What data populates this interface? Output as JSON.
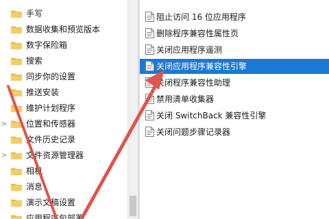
{
  "tree": {
    "items": [
      {
        "label": "手写",
        "chevron": ""
      },
      {
        "label": "数据收集和预览版本",
        "chevron": ""
      },
      {
        "label": "数字保险箱",
        "chevron": ""
      },
      {
        "label": "搜索",
        "chevron": ""
      },
      {
        "label": "同步你的设置",
        "chevron": ""
      },
      {
        "label": "推送安装",
        "chevron": ""
      },
      {
        "label": "维护计划程序",
        "chevron": ""
      },
      {
        "label": "位置和传感器",
        "chevron": ">"
      },
      {
        "label": "文件历史记录",
        "chevron": ""
      },
      {
        "label": "文件资源管理器",
        "chevron": ">"
      },
      {
        "label": "相机",
        "chevron": ""
      },
      {
        "label": "消息",
        "chevron": ""
      },
      {
        "label": "演示文稿设置",
        "chevron": ""
      },
      {
        "label": "应用程序包部署",
        "chevron": ""
      }
    ]
  },
  "list": {
    "items": [
      {
        "label": "阻止访问 16 位应用程序"
      },
      {
        "label": "删除程序兼容性属性页"
      },
      {
        "label": "关闭应用程序遥测"
      },
      {
        "label": "关闭应用程序兼容性引擎"
      },
      {
        "label": "关闭程序兼容性助理"
      },
      {
        "label": "禁用清单收集器"
      },
      {
        "label": "关闭 SwitchBack 兼容性引擎"
      },
      {
        "label": "关闭问题步骤记录器"
      }
    ],
    "selected_index": 3
  },
  "colors": {
    "selection": "#1a78d6",
    "folder": "#e8b84a",
    "arrow": "#e0544a"
  }
}
